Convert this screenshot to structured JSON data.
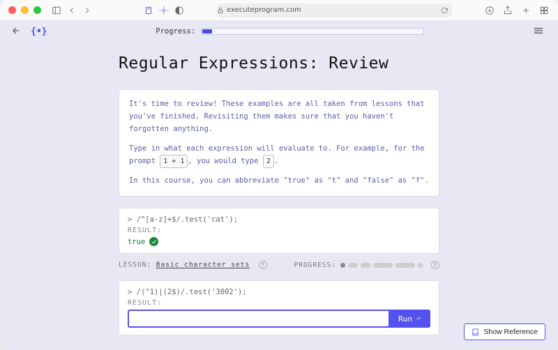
{
  "browser": {
    "url_host": "executeprogram.com"
  },
  "toolbar": {
    "progress_label": "Progress:"
  },
  "page": {
    "title": "Regular Expressions: Review"
  },
  "intro": {
    "p1": "It's time to review! These examples are all taken from lessons that you've finished. Revisiting them makes sure that you haven't forgotten anything.",
    "p2_a": "Type in what each expression will evaluate to. For example, for the prompt ",
    "p2_kbd1": "1 + 1",
    "p2_b": ", you would type ",
    "p2_kbd2": "2",
    "p2_c": ".",
    "p3": "In this course, you can abbreviate \"true\" as \"t\" and \"false\" as \"f\"."
  },
  "exercise1": {
    "prompt": "> /^[a-z]+$/.test('cat');",
    "result_label": "RESULT:",
    "result_value": "true"
  },
  "meta": {
    "lesson_label": "LESSON:",
    "lesson_link": "Basic character sets",
    "progress_label": "PROGRESS:"
  },
  "exercise2": {
    "prompt": "> /(^1)|(2$)/.test('3002');",
    "result_label": "RESULT:",
    "input_value": "",
    "run_label": "Run"
  },
  "footer": {
    "show_reference": "Show Reference"
  }
}
